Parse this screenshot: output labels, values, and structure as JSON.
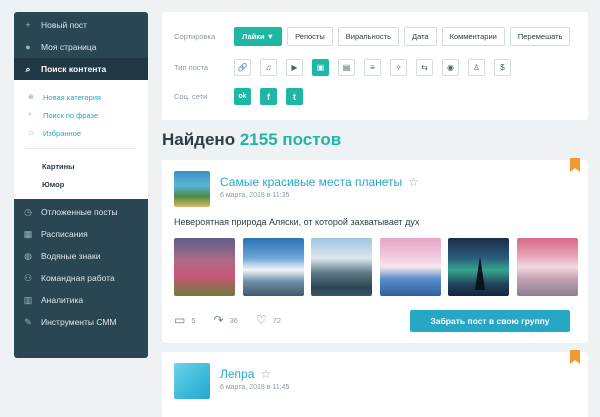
{
  "sidebar": {
    "top_items": [
      {
        "icon": "plus-icon",
        "glyph": "+",
        "label": "Новый пост"
      },
      {
        "icon": "user-icon",
        "glyph": "●",
        "label": "Моя страница"
      },
      {
        "icon": "search-icon",
        "glyph": "⌕",
        "label": "Поиск контента"
      }
    ],
    "sub_items": [
      {
        "icon": "plus-circle-icon",
        "glyph": "⊕",
        "label": "Новая категория"
      },
      {
        "icon": "search-icon",
        "glyph": "⌕",
        "label": "Поиск по фразе"
      },
      {
        "icon": "star-icon",
        "glyph": "☆",
        "label": "Избранное"
      }
    ],
    "categories": [
      "Картины",
      "Юмор"
    ],
    "bottom_items": [
      {
        "icon": "clock-icon",
        "glyph": "◷",
        "label": "Отложенные посты"
      },
      {
        "icon": "calendar-icon",
        "glyph": "▦",
        "label": "Расписания"
      },
      {
        "icon": "watermark-icon",
        "glyph": "◍",
        "label": "Водяные знаки"
      },
      {
        "icon": "team-icon",
        "glyph": "⚇",
        "label": "Командная работа"
      },
      {
        "icon": "analytics-icon",
        "glyph": "▥",
        "label": "Аналитика"
      },
      {
        "icon": "tools-icon",
        "glyph": "✎",
        "label": "Инструменты СММ"
      }
    ]
  },
  "filters": {
    "sort_label": "Сортировка",
    "sort_options": [
      "Лайки ▼",
      "Репосты",
      "Виральность",
      "Дата",
      "Комментарии",
      "Перемешать"
    ],
    "sort_selected": "Лайки ▼",
    "type_label": "Тип поста",
    "post_types": [
      {
        "icon": "link-icon",
        "glyph": "🔗"
      },
      {
        "icon": "music-icon",
        "glyph": "♫"
      },
      {
        "icon": "video-icon",
        "glyph": "▶"
      },
      {
        "icon": "image-icon",
        "glyph": "▣"
      },
      {
        "icon": "document-icon",
        "glyph": "▤"
      },
      {
        "icon": "text-icon",
        "glyph": "≡"
      },
      {
        "icon": "sparkle-icon",
        "glyph": "✧"
      },
      {
        "icon": "repost-icon",
        "glyph": "⇆"
      },
      {
        "icon": "location-icon",
        "glyph": "◉"
      },
      {
        "icon": "person-icon",
        "glyph": "♙"
      },
      {
        "icon": "money-icon",
        "glyph": "$"
      }
    ],
    "post_type_selected": "image-icon",
    "social_label": "Соц. сети",
    "socials": [
      {
        "icon": "odnoklassniki-icon",
        "glyph": "ok"
      },
      {
        "icon": "facebook-icon",
        "glyph": "f"
      },
      {
        "icon": "tumblr-icon",
        "glyph": "t"
      }
    ]
  },
  "results": {
    "prefix": "Найдено",
    "count": "2155 постов"
  },
  "posts": [
    {
      "title": "Самые красивые места планеты",
      "date": "6 марта, 2018 в 11:35",
      "text": "Невероятная природа Аляски, от которой захватывает дух",
      "comments": "5",
      "reposts": "36",
      "likes": "72",
      "cta": "Забрать пост в свою группу"
    },
    {
      "title": "Лепра",
      "date": "6 марта, 2018 в 11:45"
    }
  ],
  "colors": {
    "accent": "#1eb7a3",
    "link": "#27a7c6",
    "sidebar": "#2a4652",
    "bookmark": "#f39a2c"
  }
}
